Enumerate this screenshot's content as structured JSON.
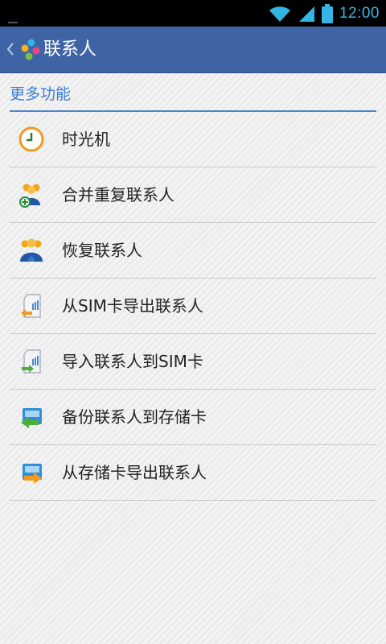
{
  "status_bar": {
    "time": "12:00",
    "icons": [
      "wifi-icon",
      "signal-icon",
      "battery-icon"
    ]
  },
  "action_bar": {
    "title": "联系人",
    "back_icon": "chevron-left-icon",
    "app_icon": "contacts-app-icon"
  },
  "section": {
    "title": "更多功能"
  },
  "menu": {
    "items": [
      {
        "label": "时光机",
        "icon": "clock-icon"
      },
      {
        "label": "合并重复联系人",
        "icon": "merge-contacts-icon"
      },
      {
        "label": "恢复联系人",
        "icon": "restore-contacts-icon"
      },
      {
        "label": "从SIM卡导出联系人",
        "icon": "sim-export-icon"
      },
      {
        "label": "导入联系人到SIM卡",
        "icon": "sim-import-icon"
      },
      {
        "label": "备份联系人到存储卡",
        "icon": "backup-to-storage-icon"
      },
      {
        "label": "从存储卡导出联系人",
        "icon": "export-from-storage-icon"
      }
    ]
  },
  "colors": {
    "action_bar": "#3e64a5",
    "accent": "#3b7fd0",
    "status_accent": "#33b5e5"
  }
}
